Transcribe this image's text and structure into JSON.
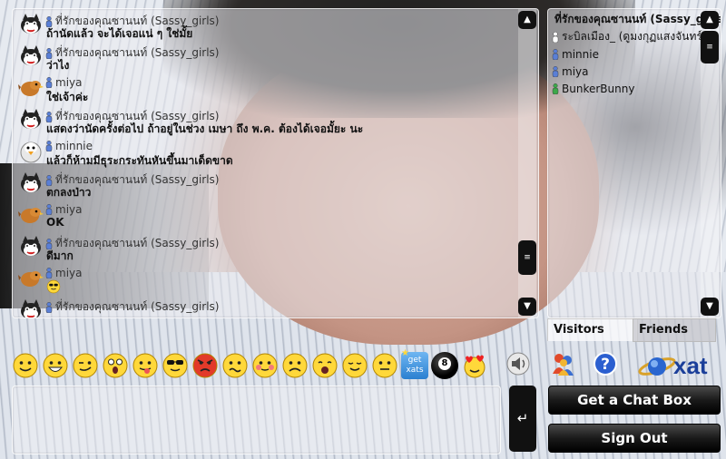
{
  "messages": [
    {
      "name": "ที่รักของคุณซานนท์ (Sassy_girls)",
      "text": "ถ้านัดแล้ว จะได้เจอแน่ ๆ ใช่มั้ย",
      "avatar": "cat-avatar",
      "status_color": "#5a7fd6"
    },
    {
      "name": "ที่รักของคุณซานนท์ (Sassy_girls)",
      "text": "ว่าไง",
      "avatar": "cat-avatar",
      "status_color": "#5a7fd6"
    },
    {
      "name": "miya",
      "text": "ใช่เจ้าค่ะ",
      "avatar": "bird-avatar",
      "status_color": "#5a7fd6"
    },
    {
      "name": "ที่รักของคุณซานนท์ (Sassy_girls)",
      "text": "แสดงว่านัดครั้งต่อไป ถ้าอยู่ในช่วง เมษา ถึง พ.ค. ต้องได้เจอมั้ยะ นะ",
      "avatar": "cat-avatar",
      "status_color": "#5a7fd6"
    },
    {
      "name": "minnie",
      "text": "แล้วก็ห้ามมีธุระกระทันหันขึ้นมาเด็ดขาด",
      "avatar": "penguin-avatar",
      "status_color": "#5a7fd6"
    },
    {
      "name": "ที่รักของคุณซานนท์ (Sassy_girls)",
      "text": "ตกลงป่าว",
      "avatar": "cat-avatar",
      "status_color": "#5a7fd6"
    },
    {
      "name": "miya",
      "text": "OK",
      "avatar": "bird-avatar",
      "status_color": "#5a7fd6"
    },
    {
      "name": "ที่รักของคุณซานนท์ (Sassy_girls)",
      "text": "ดีมาก",
      "avatar": "cat-avatar",
      "status_color": "#5a7fd6"
    },
    {
      "name": "miya",
      "text": "",
      "avatar": "bird-avatar",
      "status_color": "#5a7fd6",
      "smiley": "cool-smiley"
    },
    {
      "name": "ที่รักของคุณซานนท์ (Sassy_girls)",
      "text": "",
      "avatar": "cat-avatar",
      "status_color": "#5a7fd6"
    }
  ],
  "users": [
    {
      "name": "ที่รักของคุณซานนท์ (Sassy_girls)",
      "color": "#5a7fd6",
      "bold": true
    },
    {
      "name": "ระบิลเมือง_ (ดูมงกุฏแสงจันทร์)",
      "color": "#ffffff",
      "bold": false
    },
    {
      "name": "minnie",
      "color": "#5a7fd6",
      "bold": false
    },
    {
      "name": "miya",
      "color": "#5a7fd6",
      "bold": false
    },
    {
      "name": "BunkerBunny",
      "color": "#3da84a",
      "bold": false
    }
  ],
  "tabs": {
    "visitors": "Visitors",
    "friends": "Friends"
  },
  "smileys": [
    "smile",
    "big-grin",
    "wink",
    "surprised",
    "tongue",
    "cool",
    "angry",
    "confused",
    "blush",
    "sad",
    "yawn",
    "content",
    "neutral",
    "get-xats",
    "eight-ball",
    "hearts"
  ],
  "get_xats_label_1": "get",
  "get_xats_label_2": "xats",
  "eight_ball_label": "8",
  "buttons": {
    "get_chat_box": "Get a Chat Box",
    "sign_out": "Sign Out"
  },
  "logo_text": "xat",
  "input": {
    "value": ""
  },
  "send_icon": "↵"
}
